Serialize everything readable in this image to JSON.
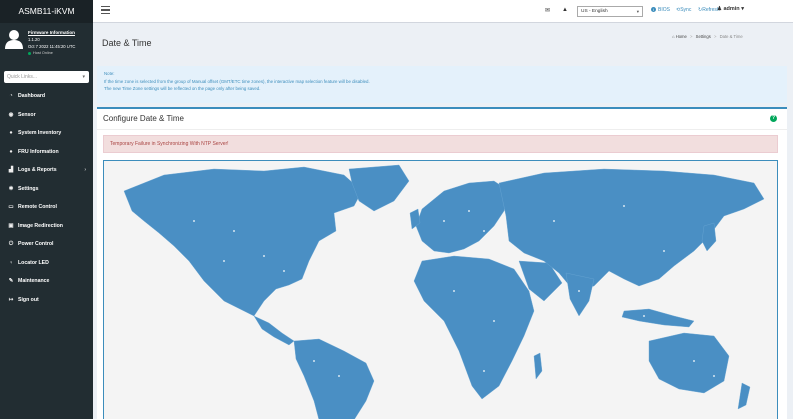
{
  "sidebar": {
    "brand": "ASMB11-iKVM",
    "firmware_link": "Firmware Information",
    "firmware_version": "1.1.20",
    "firmware_date": "Oct 7 2022 11:45:20 UTC",
    "host_status": "Host Online",
    "quick_links_placeholder": "Quick Links...",
    "nav": [
      {
        "label": "Dashboard",
        "icon": "tachometer-icon"
      },
      {
        "label": "Sensor",
        "icon": "sensor-icon"
      },
      {
        "label": "System Inventory",
        "icon": "info-circle-icon"
      },
      {
        "label": "FRU Information",
        "icon": "info-circle-icon"
      },
      {
        "label": "Logs & Reports",
        "icon": "bar-chart-icon"
      },
      {
        "label": "Settings",
        "icon": "gear-icon"
      },
      {
        "label": "Remote Control",
        "icon": "desktop-icon"
      },
      {
        "label": "Image Redirection",
        "icon": "disc-icon"
      },
      {
        "label": "Power Control",
        "icon": "power-icon"
      },
      {
        "label": "Locator LED",
        "icon": "lightbulb-icon"
      },
      {
        "label": "Maintenance",
        "icon": "wrench-icon"
      },
      {
        "label": "Sign out",
        "icon": "sign-out-icon"
      }
    ]
  },
  "topbar": {
    "language": "US - English",
    "bios": "BIOS",
    "sync": "Sync",
    "refresh": "Refresh",
    "user": "admin"
  },
  "page": {
    "title": "Date & Time",
    "breadcrumb": [
      "Home",
      "Settings",
      "Date & Time"
    ],
    "note_title": "Note:",
    "note_line1": "If the time zone is selected from the group of Manual offset (GMT/ETC time zones), the interactive map selection feature will be disabled.",
    "note_line2": "The new Time Zone settings will be reflected on the page only after being saved.",
    "card_title": "Configure Date & Time",
    "alert": "Temporary Failure in Synchronizing With NTP Server!"
  },
  "colors": {
    "sidebar_bg": "#222d32",
    "accent": "#3c8dbc",
    "map_land": "#4a8fc4",
    "alert_bg": "#f2dede",
    "online": "#00a65a"
  }
}
